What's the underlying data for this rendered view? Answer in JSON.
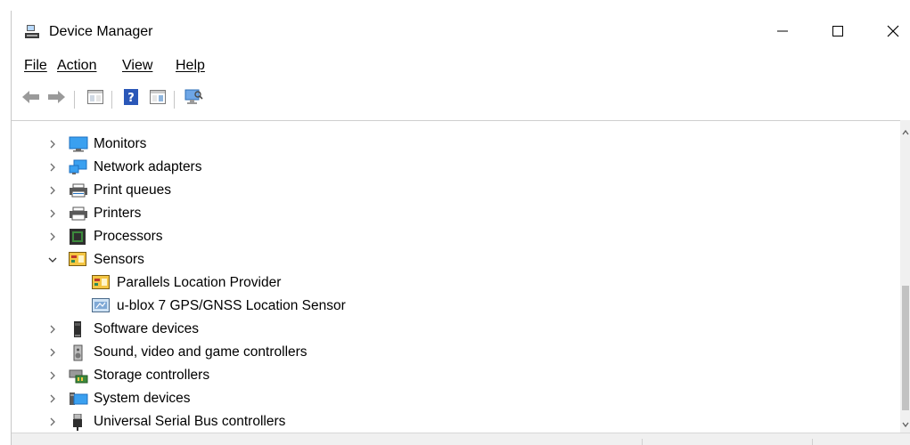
{
  "window": {
    "title": "Device Manager"
  },
  "menu": {
    "items": [
      "File",
      "Action",
      "View",
      "Help"
    ]
  },
  "toolbar": {
    "buttons": [
      "back-arrow-icon",
      "forward-arrow-icon",
      "properties-icon",
      "help-icon",
      "update-driver-icon",
      "scan-hardware-icon"
    ]
  },
  "tree": {
    "items": [
      {
        "label": "Monitors",
        "expanded": false,
        "icon": "monitor-icon"
      },
      {
        "label": "Network adapters",
        "expanded": false,
        "icon": "network-adapter-icon"
      },
      {
        "label": "Print queues",
        "expanded": false,
        "icon": "printer-queue-icon"
      },
      {
        "label": "Printers",
        "expanded": false,
        "icon": "printer-icon"
      },
      {
        "label": "Processors",
        "expanded": false,
        "icon": "processor-icon"
      },
      {
        "label": "Sensors",
        "expanded": true,
        "icon": "sensor-icon"
      },
      {
        "label": "Parallels Location Provider",
        "child": true,
        "icon": "sensor-device-icon"
      },
      {
        "label": "u-blox 7 GPS/GNSS Location Sensor",
        "child": true,
        "icon": "gps-sensor-icon"
      },
      {
        "label": "Software devices",
        "expanded": false,
        "icon": "software-device-icon"
      },
      {
        "label": "Sound, video and game controllers",
        "expanded": false,
        "icon": "speaker-icon"
      },
      {
        "label": "Storage controllers",
        "expanded": false,
        "icon": "storage-controller-icon"
      },
      {
        "label": "System devices",
        "expanded": false,
        "icon": "system-devices-icon"
      },
      {
        "label": "Universal Serial Bus controllers",
        "expanded": false,
        "icon": "usb-icon"
      }
    ]
  },
  "colors": {
    "monitor_blue": "#1e88e5",
    "sensor_yellow": "#f4c542",
    "chevron": "#6b6b6b",
    "separator": "#c6c6c6"
  }
}
